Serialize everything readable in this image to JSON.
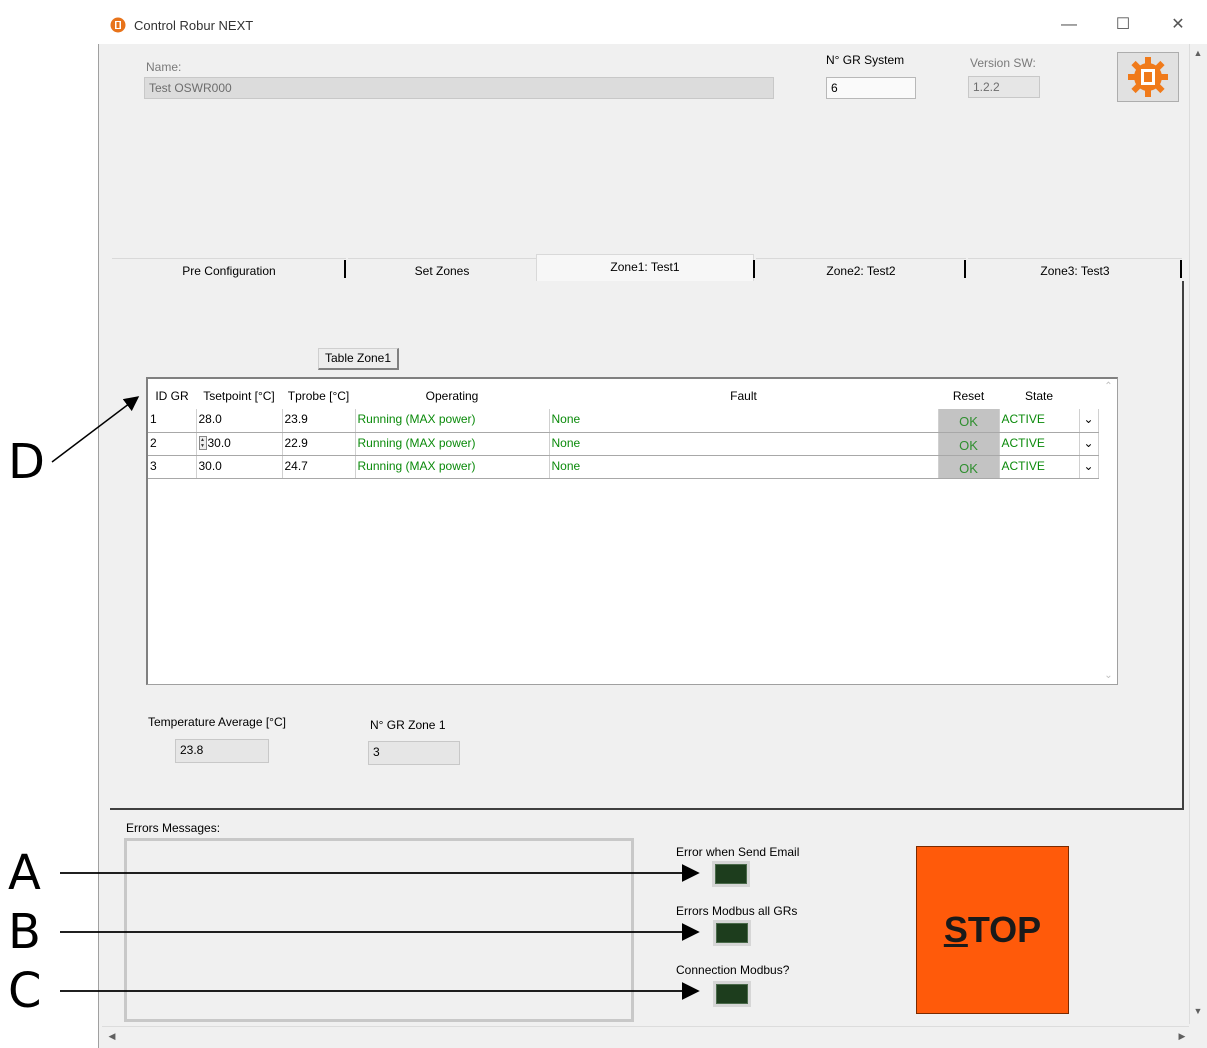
{
  "window": {
    "title": "Control Robur NEXT",
    "minimize": "—",
    "maximize": "☐",
    "close": "✕"
  },
  "header": {
    "name_label": "Name:",
    "name_value": "Test OSWR000",
    "gr_system_label": "N° GR System",
    "gr_system_value": "6",
    "version_label": "Version SW:",
    "version_value": "1.2.2"
  },
  "tabs": [
    {
      "label": "Pre Configuration"
    },
    {
      "label": "Set Zones"
    },
    {
      "label": "Zone1: Test1"
    },
    {
      "label": "Zone2: Test2"
    },
    {
      "label": "Zone3: Test3"
    }
  ],
  "zone": {
    "table_button": "Table Zone1",
    "columns": [
      "ID GR",
      "Tsetpoint [°C]",
      "Tprobe [°C]",
      "Operating",
      "Fault",
      "Reset",
      "State"
    ],
    "rows": [
      {
        "id": "1",
        "tsetpoint": "28.0",
        "tprobe": "23.9",
        "operating": "Running (MAX power)",
        "fault": "None",
        "reset": "OK",
        "state": "ACTIVE"
      },
      {
        "id": "2",
        "tsetpoint": "30.0",
        "tprobe": "22.9",
        "operating": "Running (MAX power)",
        "fault": "None",
        "reset": "OK",
        "state": "ACTIVE"
      },
      {
        "id": "3",
        "tsetpoint": "30.0",
        "tprobe": "24.7",
        "operating": "Running (MAX power)",
        "fault": "None",
        "reset": "OK",
        "state": "ACTIVE"
      }
    ],
    "temp_avg_label": "Temperature Average [°C]",
    "temp_avg_value": "23.8",
    "gr_zone_label": "N° GR Zone 1",
    "gr_zone_value": "3"
  },
  "bottom": {
    "errors_label": "Errors Messages:",
    "led_email_label": "Error when Send Email",
    "led_modbus_label": "Errors Modbus all GRs",
    "led_connection_label": "Connection Modbus?",
    "stop_hotkey": "S",
    "stop_rest": "TOP"
  },
  "callouts": {
    "a": "A",
    "b": "B",
    "c": "C",
    "d": "D"
  },
  "colors": {
    "stop_button": "#ff5a0a",
    "led_off": "#1d3d1d",
    "status_green": "#0a8a0a"
  }
}
